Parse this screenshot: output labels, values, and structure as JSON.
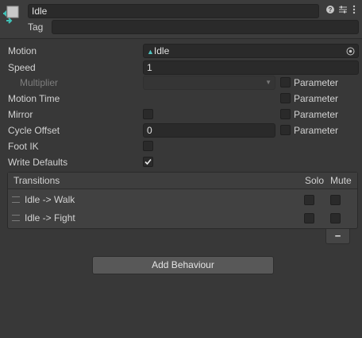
{
  "header": {
    "name_value": "Idle",
    "tag_label": "Tag",
    "tag_value": "",
    "icons": [
      "state-icon",
      "help-icon",
      "presets-icon",
      "kebab-menu-icon"
    ]
  },
  "fields": {
    "motion_label": "Motion",
    "motion_value": "Idle",
    "speed_label": "Speed",
    "speed_value": "1",
    "multiplier_label": "Multiplier",
    "motion_time_label": "Motion Time",
    "mirror_label": "Mirror",
    "cycle_offset_label": "Cycle Offset",
    "cycle_offset_value": "0",
    "foot_ik_label": "Foot IK",
    "write_defaults_label": "Write Defaults",
    "parameter_label": "Parameter"
  },
  "transitions": {
    "header": "Transitions",
    "solo_label": "Solo",
    "mute_label": "Mute",
    "rows": [
      {
        "label": "Idle -> Walk"
      },
      {
        "label": "Idle -> Fight"
      }
    ],
    "remove_label": "−"
  },
  "add_behaviour_label": "Add Behaviour",
  "colors": {
    "background": "#383838",
    "field": "#2a2a2a",
    "button": "#585858",
    "text": "#d2d2d2"
  }
}
